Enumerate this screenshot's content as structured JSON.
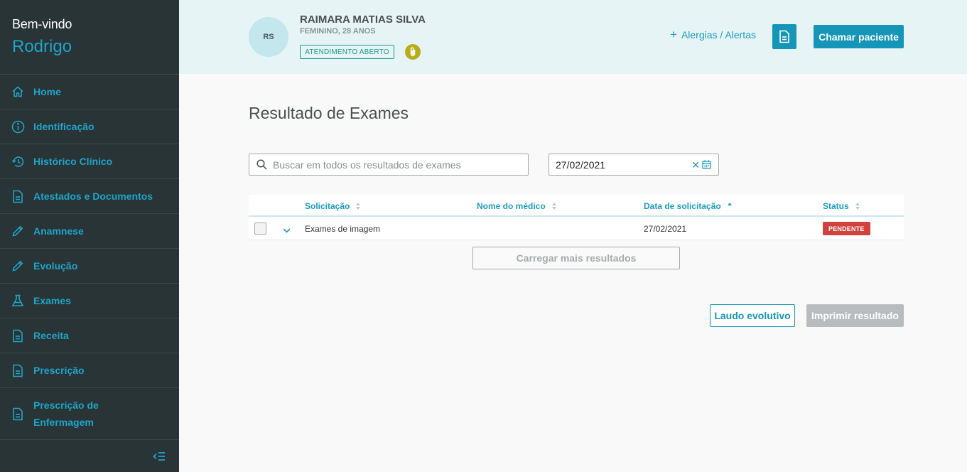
{
  "sidebar": {
    "welcome": "Bem-vindo",
    "username": "Rodrigo",
    "items": [
      {
        "label": "Home",
        "icon": "home-icon"
      },
      {
        "label": "Identificação",
        "icon": "info-icon"
      },
      {
        "label": "Histórico Clínico",
        "icon": "history-icon"
      },
      {
        "label": "Atestados e Documentos",
        "icon": "document-icon"
      },
      {
        "label": "Anamnese",
        "icon": "pencil-icon"
      },
      {
        "label": "Evolução",
        "icon": "pencil-icon"
      },
      {
        "label": "Exames",
        "icon": "flask-icon"
      },
      {
        "label": "Receita",
        "icon": "document-icon"
      },
      {
        "label": "Prescrição",
        "icon": "document-icon"
      },
      {
        "label_line1": "Prescrição de",
        "label_line2": "Enfermagem",
        "icon": "document-icon"
      }
    ]
  },
  "header": {
    "avatar_initials": "RS",
    "patient_name": "RAIMARA MATIAS SILVA",
    "patient_info": "FEMININO, 28 ANOS",
    "status": "ATENDIMENTO ABERTO",
    "alerts_link": "Alergias / Alertas",
    "call_button": "Chamar paciente"
  },
  "main": {
    "title": "Resultado de Exames",
    "search_placeholder": "Buscar em todos os resultados de exames",
    "date_value": "27/02/2021",
    "columns": [
      "Solicitação",
      "Nome do médico",
      "Data de solicitação",
      "Status"
    ],
    "sorted_column": "Data de solicitação",
    "rows": [
      {
        "solicitacao": "Exames de imagem",
        "medico": "",
        "data": "27/02/2021",
        "status": "PENDENTE"
      }
    ],
    "load_more": "Carregar mais resultados",
    "laudo_button": "Laudo evolutivo",
    "print_button": "Imprimir resultado"
  },
  "colors": {
    "sidebar_bg": "#283436",
    "accent": "#1596b9",
    "header_bg": "#e6f4f5",
    "status_tag": "#1b9a8c",
    "pending_badge": "#d0423b"
  }
}
